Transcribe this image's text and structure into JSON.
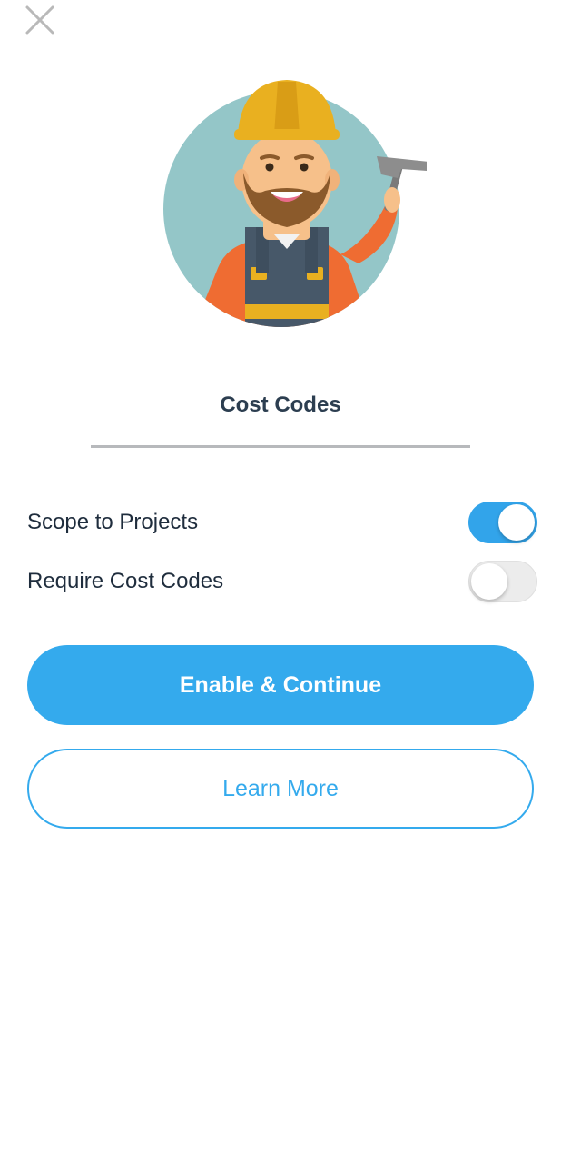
{
  "screen": {
    "title": "Cost Codes"
  },
  "icons": {
    "close": "close-icon",
    "illustration": "construction-worker-illustration"
  },
  "settings": [
    {
      "label": "Scope to Projects",
      "enabled": true
    },
    {
      "label": "Require Cost Codes",
      "enabled": false
    }
  ],
  "actions": {
    "primary_label": "Enable & Continue",
    "secondary_label": "Learn More"
  },
  "colors": {
    "accent": "#34aaed",
    "toggle_on": "#32a4ea",
    "toggle_off": "#ececec",
    "title_text": "#2c3e50",
    "body_text": "#1f2d3d"
  }
}
